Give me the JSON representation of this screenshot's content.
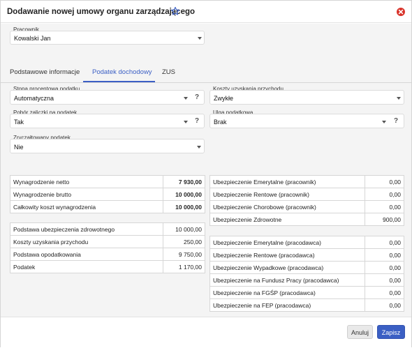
{
  "dialog": {
    "title": "Dodawanie nowej umowy organu zarządzającego"
  },
  "employee": {
    "label": "Pracownik",
    "value": "Kowalski Jan"
  },
  "tabs": [
    {
      "label": "Podstawowe informacje"
    },
    {
      "label": "Podatek dochodowy"
    },
    {
      "label": "ZUS"
    }
  ],
  "active_tab": "Podatek dochodowy",
  "form": {
    "tax_rate": {
      "label": "Stopa procentowa podatku",
      "value": "Automatyczna"
    },
    "advance": {
      "label": "Pobór zaliczki na podatek",
      "value": "Tak"
    },
    "flat_tax": {
      "label": "Zryczałtowany podatek",
      "value": "Nie"
    },
    "costs": {
      "label": "Koszty uzyskania przychodu",
      "value": "Zwykłe"
    },
    "relief": {
      "label": "Ulga podatkowa",
      "value": "Brak"
    },
    "help": "?"
  },
  "left_summary_1": [
    {
      "label": "Wynagrodzenie netto",
      "value": "7 930,00"
    },
    {
      "label": "Wynagrodzenie brutto",
      "value": "10 000,00"
    },
    {
      "label": "Całkowity koszt wynagrodzenia",
      "value": "10 000,00"
    }
  ],
  "left_summary_2": [
    {
      "label": "Podstawa ubezpieczenia zdrowotnego",
      "value": "10 000,00"
    },
    {
      "label": "Koszty uzyskania przychodu",
      "value": "250,00"
    },
    {
      "label": "Podstawa opodatkowania",
      "value": "9 750,00"
    },
    {
      "label": "Podatek",
      "value": "1 170,00"
    }
  ],
  "right_summary_1": [
    {
      "label": "Ubezpieczenie Emerytalne (pracownik)",
      "value": "0,00"
    },
    {
      "label": "Ubezpieczenie Rentowe (pracownik)",
      "value": "0,00"
    },
    {
      "label": "Ubezpieczenie Chorobowe (pracownik)",
      "value": "0,00"
    },
    {
      "label": "Ubezpieczenie Zdrowotne",
      "value": "900,00"
    }
  ],
  "right_summary_2": [
    {
      "label": "Ubezpieczenie Emerytalne (pracodawca)",
      "value": "0,00"
    },
    {
      "label": "Ubezpieczenie Rentowe (pracodawca)",
      "value": "0,00"
    },
    {
      "label": "Ubezpieczenie Wypadkowe (pracodawca)",
      "value": "0,00"
    },
    {
      "label": "Ubezpieczenie na Fundusz Pracy (pracodawca)",
      "value": "0,00"
    },
    {
      "label": "Ubezpieczenie na FGŚP (pracodawca)",
      "value": "0,00"
    },
    {
      "label": "Ubezpieczenie na FEP (pracodawca)",
      "value": "0,00"
    }
  ],
  "footer": {
    "cancel": "Anuluj",
    "save": "Zapisz"
  },
  "colors": {
    "accent": "#3b5fc4",
    "close": "#d9342b",
    "background": "#f4f4f4"
  },
  "icons": {
    "favorite": "star-icon",
    "close": "close-icon",
    "dropdown": "chevron-down-icon"
  }
}
